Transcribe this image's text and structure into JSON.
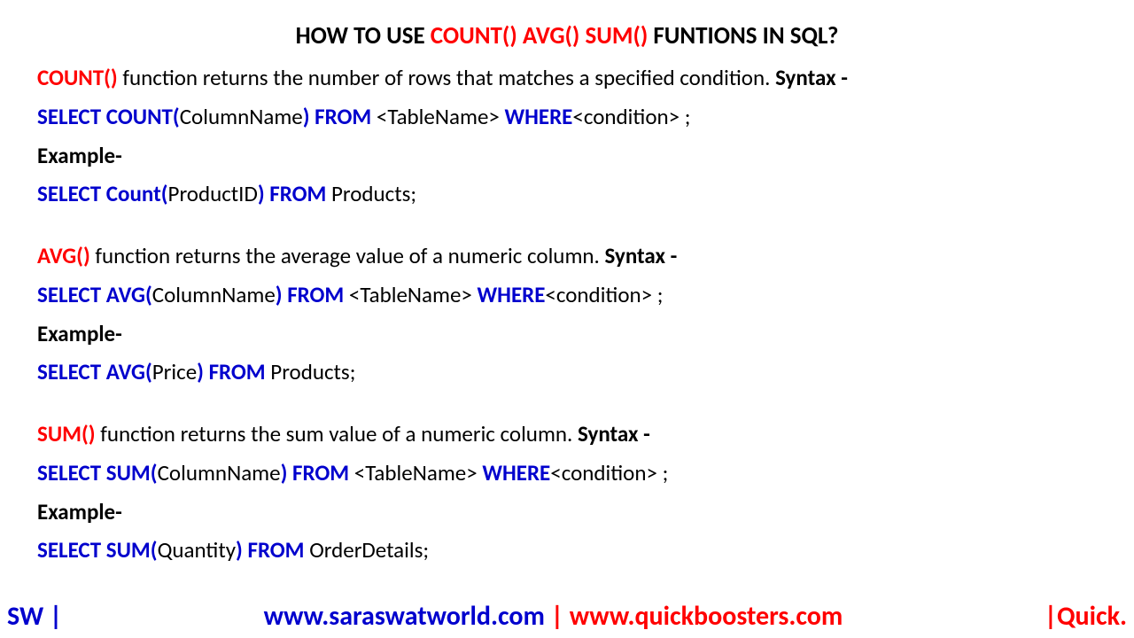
{
  "title": {
    "pre": "HOW TO USE ",
    "fns": "COUNT() AVG() SUM()",
    "post": " FUNTIONS IN SQL?"
  },
  "count": {
    "name": "COUNT()",
    "desc": " function returns the number of rows that matches a specified condition. ",
    "syntaxLabel": "Syntax -",
    "syntax": {
      "select": "SELECT  COUNT(",
      "col": "ColumnName",
      "closeFrom": ")  FROM ",
      "table": "<TableName> ",
      "where": "WHERE",
      "cond": "<condition>  ;"
    },
    "exLabel": "Example-",
    "ex": {
      "select": "SELECT  Count(",
      "col": "ProductID",
      "closeFrom": ")  FROM ",
      "table": "Products;"
    }
  },
  "avg": {
    "name": "AVG()",
    "desc": " function returns the average value of a numeric column. ",
    "syntaxLabel": "Syntax -",
    "syntax": {
      "select": "SELECT  AVG(",
      "col": "ColumnName",
      "closeFrom": ")  FROM ",
      "table": "<TableName> ",
      "where": "WHERE",
      "cond": "<condition>  ;"
    },
    "exLabel": "Example-",
    "ex": {
      "select": "SELECT  AVG(",
      "col": "Price",
      "closeFrom": ")  FROM ",
      "table": "Products;"
    }
  },
  "sum": {
    "name": "SUM()",
    "desc": " function returns the sum value of a numeric column. ",
    "syntaxLabel": "Syntax -",
    "syntax": {
      "select": "SELECT  SUM(",
      "col": "ColumnName",
      "closeFrom": ")  FROM ",
      "table": "<TableName> ",
      "where": "WHERE",
      "cond": "<condition>  ;"
    },
    "exLabel": "Example-",
    "ex": {
      "select": "SELECT  SUM(",
      "col": "Quantity",
      "closeFrom": ")  FROM ",
      "table": "OrderDetails;"
    }
  },
  "footer": {
    "left": "SW |",
    "url1": "www.saraswatworld.com",
    "sep": " | ",
    "url2": "www.quickboosters.com",
    "right": "|Quick."
  }
}
